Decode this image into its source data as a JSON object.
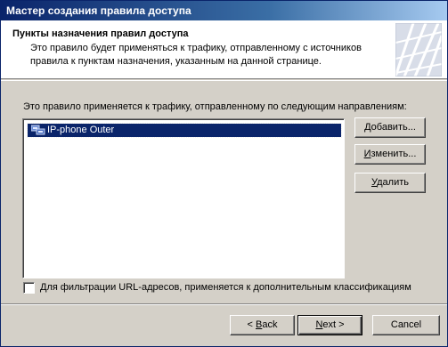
{
  "window": {
    "title": "Мастер создания правила доступа"
  },
  "header": {
    "title": "Пункты назначения правил доступа",
    "description": "Это правило будет применяться к трафику, отправленному с источников правила к пунктам назначения, указанным на данной странице."
  },
  "main": {
    "prompt": "Это правило применяется к трафику, отправленному по следующим направлениям:",
    "destinations": [
      {
        "label": "IP-phone Outer",
        "icon": "network-icon",
        "selected": true
      }
    ],
    "buttons": {
      "add": {
        "mnemonic": "Д",
        "rest": "обавить..."
      },
      "edit": {
        "mnemonic": "И",
        "rest": "зменить..."
      },
      "delete": {
        "mnemonic": "У",
        "rest": "далить"
      }
    },
    "url_filter": {
      "checked": false,
      "label": "Для фильтрации URL-адресов, применяется к дополнительным классификациям"
    }
  },
  "footer": {
    "back": {
      "prefix": "< ",
      "mnemonic": "B",
      "rest": "ack"
    },
    "next": {
      "mnemonic": "N",
      "rest": "ext >"
    },
    "cancel": "Cancel"
  },
  "colors": {
    "selection": "#0a246a",
    "dialog_bg": "#d4d0c8",
    "title_gradient_start": "#0a246a",
    "title_gradient_end": "#a6caf0"
  }
}
